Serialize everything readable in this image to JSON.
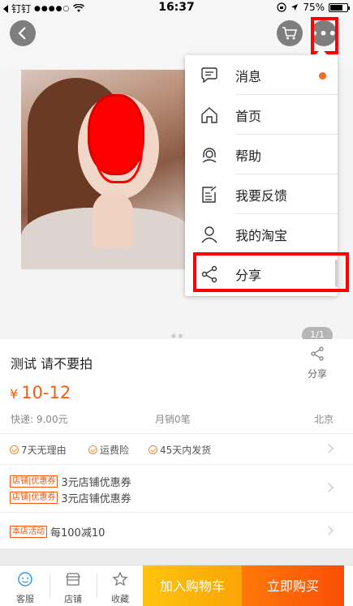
{
  "status_bar": {
    "carrier": "钉钉",
    "signal": "●●●●○",
    "time": "16:37",
    "battery": "75%"
  },
  "menu": {
    "items": [
      {
        "label": "消息",
        "icon": "chat-bubble-icon"
      },
      {
        "label": "首页",
        "icon": "home-icon"
      },
      {
        "label": "帮助",
        "icon": "headset-icon"
      },
      {
        "label": "我要反馈",
        "icon": "feedback-icon"
      },
      {
        "label": "我的淘宝",
        "icon": "user-icon"
      },
      {
        "label": "分享",
        "icon": "share-icon"
      }
    ]
  },
  "gallery": {
    "pager": "1/1"
  },
  "product": {
    "title": "测试  请不要拍",
    "share_label": "分享",
    "currency": "¥",
    "price": "10-12",
    "shipping": "快递: 9.00元",
    "monthly_sales": "月销0笔",
    "location": "北京"
  },
  "services": [
    "7天无理由",
    "运费险",
    "45天内发货"
  ],
  "coupons": {
    "tag": "店铺",
    "tag2": "优惠券",
    "lines": [
      "3元店铺优惠券",
      "3元店铺优惠券"
    ]
  },
  "activity": {
    "tag": "本店活动",
    "text": "每100减10"
  },
  "bottom_bar": {
    "service": "客服",
    "shop": "店铺",
    "favorite": "收藏",
    "add_cart": "加入购物车",
    "buy_now": "立即购买"
  },
  "colors": {
    "accent": "#f95b11",
    "highlight": "#ff0000"
  }
}
